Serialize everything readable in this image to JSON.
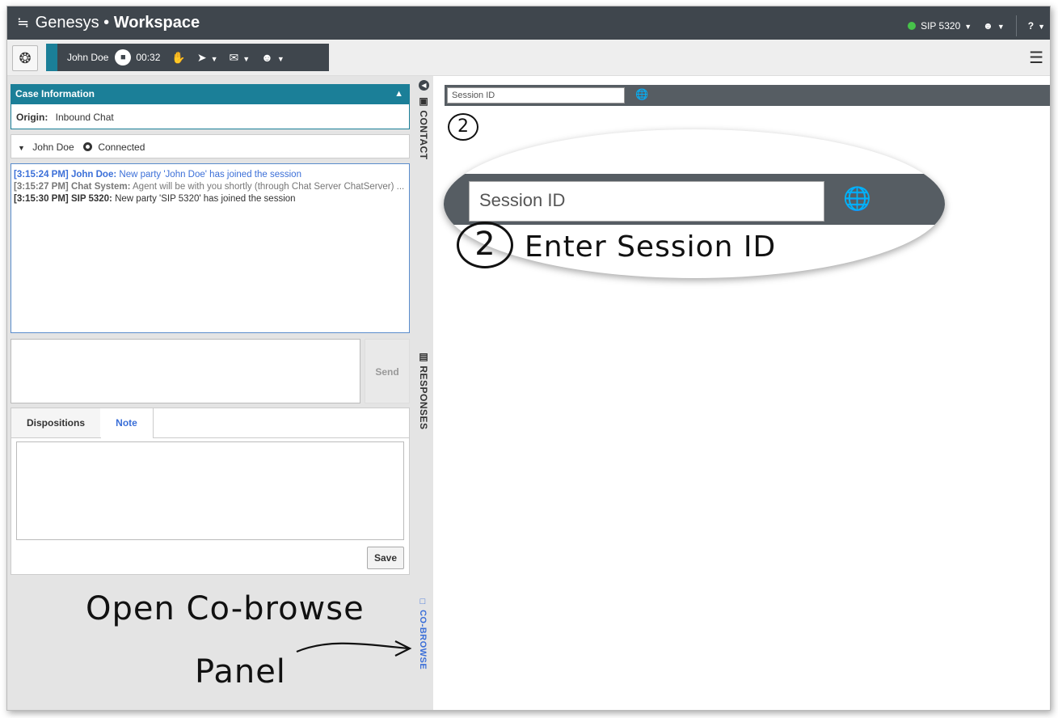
{
  "app": {
    "brand": "Genesys",
    "separator": "•",
    "title": "Workspace",
    "status_label": "SIP 5320",
    "help_label": "?"
  },
  "toolbar": {
    "contact_name": "John Doe",
    "timer": "00:32"
  },
  "case": {
    "header": "Case Information",
    "origin_label": "Origin:",
    "origin_value": "Inbound Chat"
  },
  "party": {
    "name": "John Doe",
    "status": "Connected"
  },
  "transcript": [
    {
      "time": "[3:15:24 PM]",
      "who": "John Doe:",
      "text": "New party 'John Doe' has joined the session"
    },
    {
      "time": "[3:15:27 PM]",
      "who": "Chat System:",
      "text": "Agent will be with you shortly (through Chat Server ChatServer) ..."
    },
    {
      "time": "[3:15:30 PM]",
      "who": "SIP 5320:",
      "text": "New party 'SIP 5320' has joined the session"
    }
  ],
  "compose": {
    "send_label": "Send"
  },
  "tabs": {
    "dispositions": "Dispositions",
    "note": "Note",
    "save_label": "Save"
  },
  "side": {
    "contact": "CONTACT",
    "responses": "RESPONSES",
    "cobrowse": "CO-BROWSE"
  },
  "cobrowse": {
    "session_placeholder": "Session ID",
    "zoom_placeholder": "Session ID"
  },
  "annotations": {
    "step": "2",
    "enter": "Enter Session ID",
    "open_line1": "Open Co-browse",
    "open_line2": "Panel"
  },
  "colors": {
    "accent_teal": "#1b7f98",
    "topbar": "#3f464d",
    "link_blue": "#3b6fd8",
    "status_green": "#47c24a"
  }
}
